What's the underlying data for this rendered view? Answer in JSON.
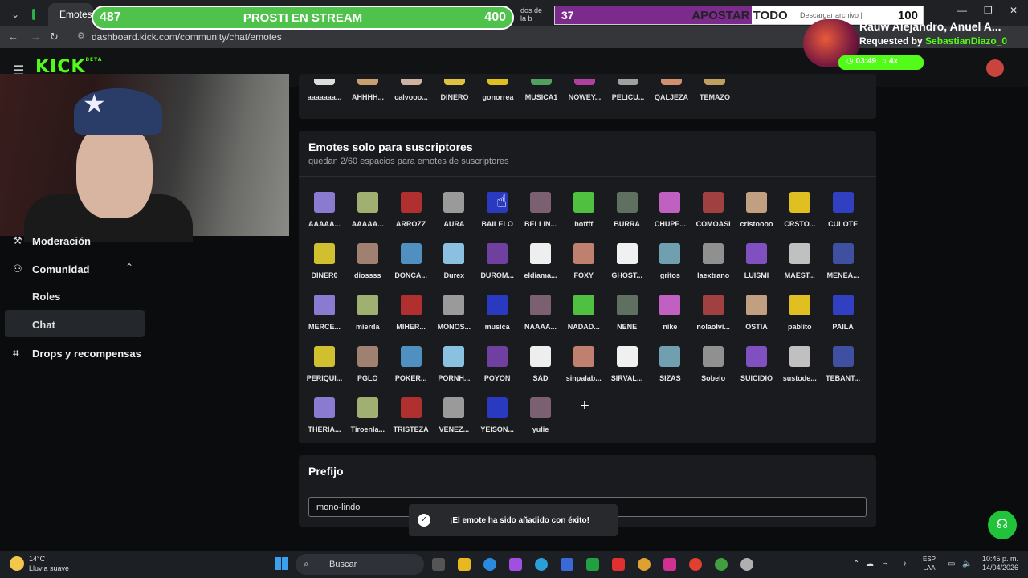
{
  "browser": {
    "active_tab": "Emotes",
    "tab_snippet": "dos de la b",
    "download_tab": "Descargar archivo |",
    "url": "dashboard.kick.com/community/chat/emotes"
  },
  "overlays": {
    "poll": {
      "left_points": "487",
      "title": "PROSTI EN STREAM",
      "right_points": "400"
    },
    "bet": {
      "left_points": "37",
      "title": "APOSTAR TODO",
      "right_points": "100"
    },
    "music": {
      "song": "Rauw Alejandro, Anuel A...",
      "requested_prefix": "Requested by",
      "requester": "SebastianDiazo_0",
      "time": "03:49",
      "speed": "4x"
    }
  },
  "kick": {
    "logo": "KICK",
    "beta": "BETA"
  },
  "sidebar": {
    "items": [
      {
        "label": "Moderación"
      },
      {
        "label": "Comunidad"
      },
      {
        "label": "Roles"
      },
      {
        "label": "Chat"
      },
      {
        "label": "Drops y recompensas"
      }
    ]
  },
  "top_emotes": [
    "aaaaaaa...",
    "AHHHH...",
    "calvooo...",
    "DINERO",
    "gonorrea",
    "MUSICA1",
    "NOWEY...",
    "PELICU...",
    "QALJEZA",
    "TEMAZO"
  ],
  "sub_emotes": {
    "title": "Emotes solo para suscriptores",
    "subtitle": "quedan 2/60 espacios para emotes de suscriptores",
    "items": [
      "AAAAA...",
      "AAAAA...",
      "ARROZZ",
      "AURA",
      "BAILELO",
      "BELLIN...",
      "boffff",
      "BURRA",
      "CHUPE...",
      "COMOASI",
      "cristoooo",
      "CRSTO...",
      "CULOTE",
      "DINER0",
      "diossss",
      "DONCA...",
      "Durex",
      "DUROM...",
      "eldiama...",
      "FOXY",
      "GHOST...",
      "gritos",
      "laextrano",
      "LUISMI",
      "MAEST...",
      "MENEA...",
      "MERCE...",
      "mierda",
      "MIHER...",
      "MONOS...",
      "musica",
      "NAAAA...",
      "NADAD...",
      "NENE",
      "nike",
      "nolaolvi...",
      "OSTIA",
      "pablito",
      "PAILA",
      "PERIQUI...",
      "PGLO",
      "POKER...",
      "PORNH...",
      "POYON",
      "SAD",
      "sinpalab...",
      "SIRVAL...",
      "SIZAS",
      "Sobelo",
      "SUICIDIO",
      "sustode...",
      "TEBANT...",
      "THERIA...",
      "Tiroenla...",
      "TRISTEZA",
      "VENEZ...",
      "YEISON...",
      "yulie"
    ],
    "add_symbol": "+"
  },
  "prefix": {
    "title": "Prefijo",
    "value": "mono-lindo"
  },
  "toast": {
    "message": "¡El emote ha sido añadido con éxito!"
  },
  "taskbar": {
    "temp": "14°C",
    "weather": "Lluvia suave",
    "search": "Buscar",
    "lang_top": "ESP",
    "lang_bottom": "LAA",
    "time": "10:45 p. m.",
    "date": "14/04/2026"
  },
  "colors": {
    "brand": "#53fc18",
    "panel": "#191b1f",
    "background": "#0b0c0d"
  }
}
